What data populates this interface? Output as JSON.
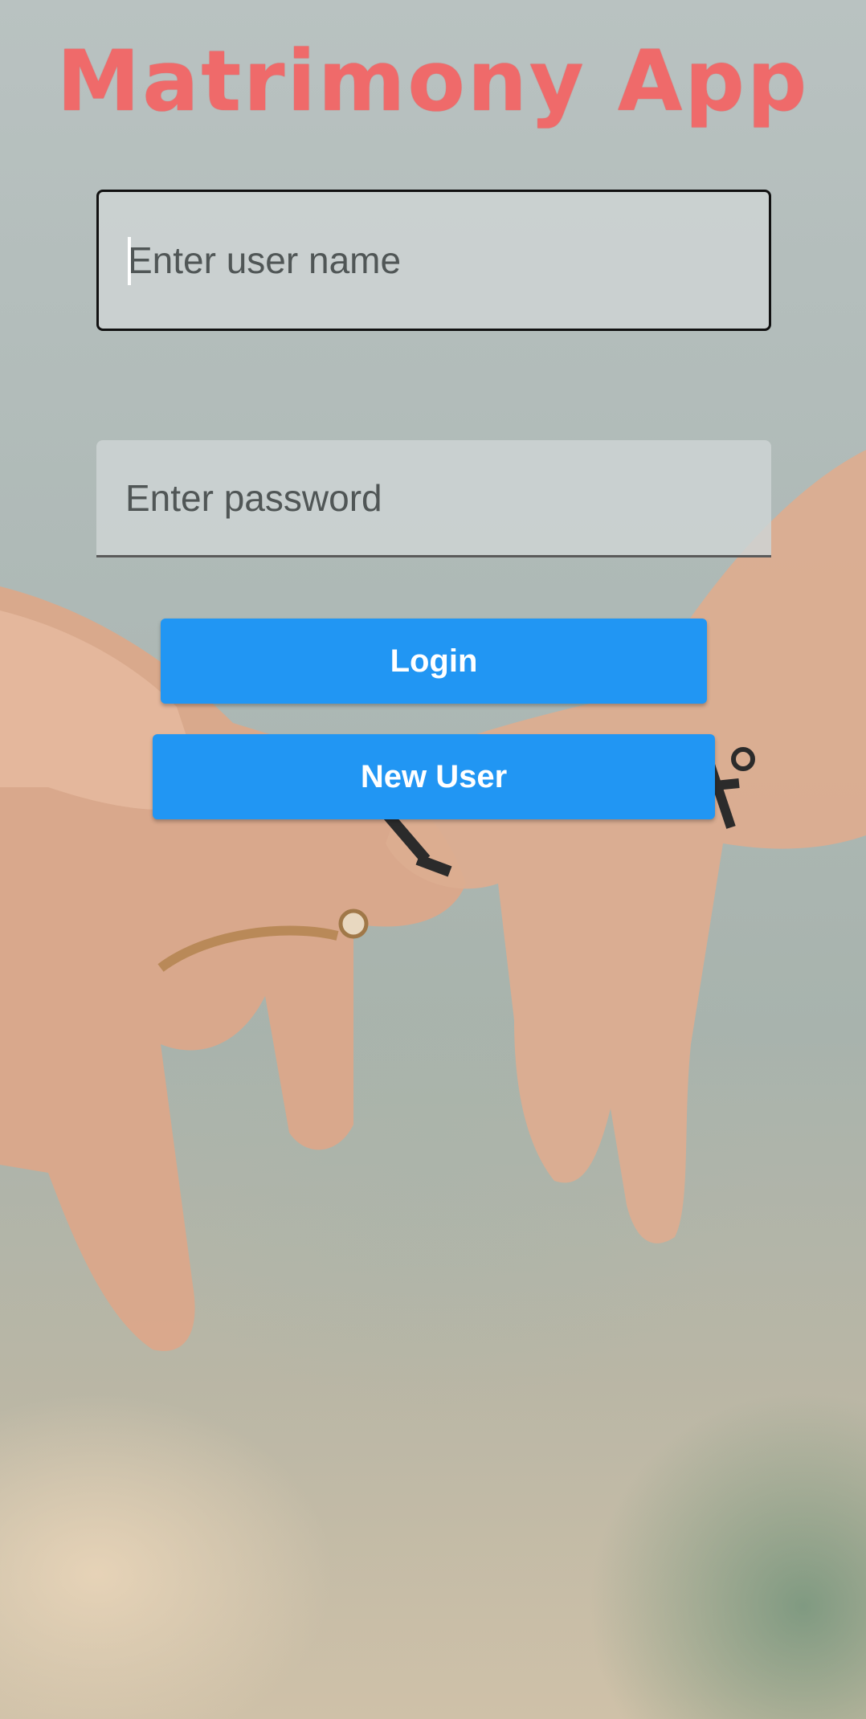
{
  "app": {
    "title": "Matrimony App"
  },
  "form": {
    "username_placeholder": "Enter user name",
    "username_value": "",
    "password_placeholder": "Enter password",
    "password_value": "",
    "login_label": "Login",
    "new_user_label": "New User"
  },
  "colors": {
    "title": "#ef6a6a",
    "button": "#2196f3",
    "button_text": "#ffffff"
  }
}
